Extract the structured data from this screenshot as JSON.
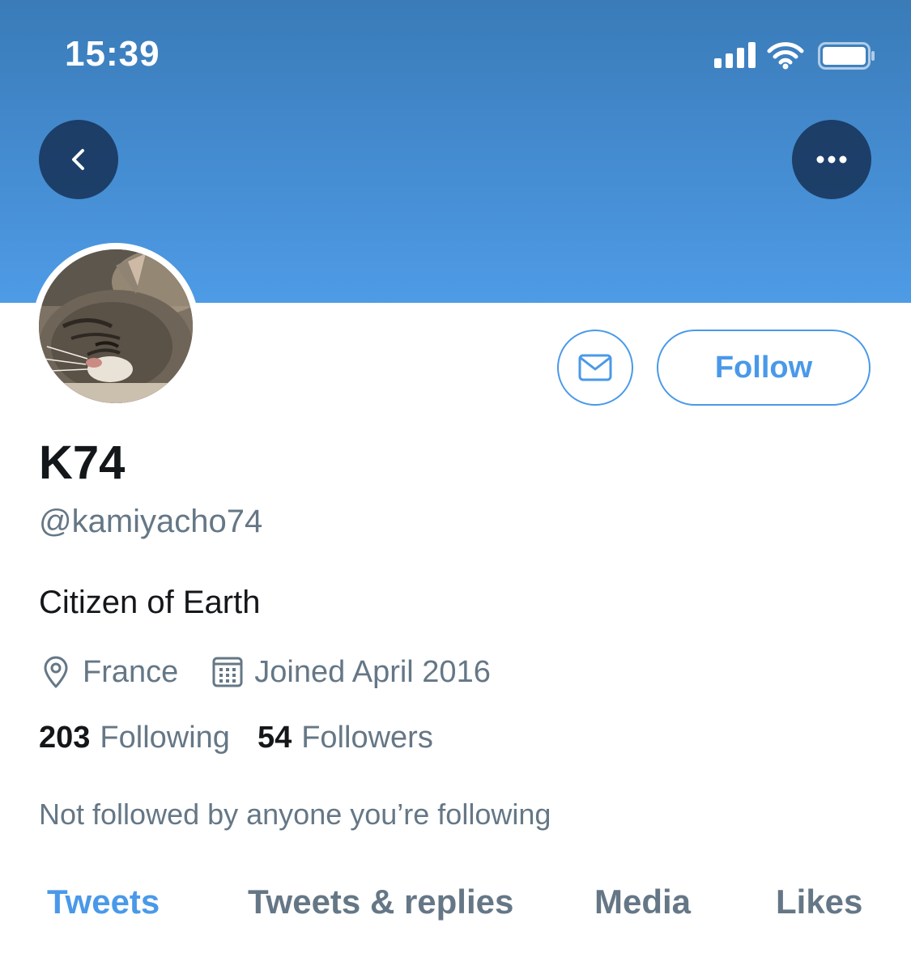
{
  "status_bar": {
    "time": "15:39"
  },
  "header": {
    "banner_color": "#4a94df",
    "back_icon": "chevron-left-icon",
    "more_icon": "ellipsis-icon"
  },
  "profile": {
    "display_name": "K74",
    "handle": "@kamiyacho74",
    "bio": "Citizen of Earth",
    "location": "France",
    "joined": "Joined April 2016",
    "following_count": "203",
    "following_label": "Following",
    "followers_count": "54",
    "followers_label": "Followers",
    "mutuals_note": "Not followed by anyone you’re following"
  },
  "actions": {
    "message_icon": "envelope-icon",
    "follow_label": "Follow",
    "accent": "#4a99e9"
  },
  "tabs": [
    {
      "label": "Tweets",
      "active": true
    },
    {
      "label": "Tweets & replies",
      "active": false
    },
    {
      "label": "Media",
      "active": false
    },
    {
      "label": "Likes",
      "active": false
    }
  ]
}
